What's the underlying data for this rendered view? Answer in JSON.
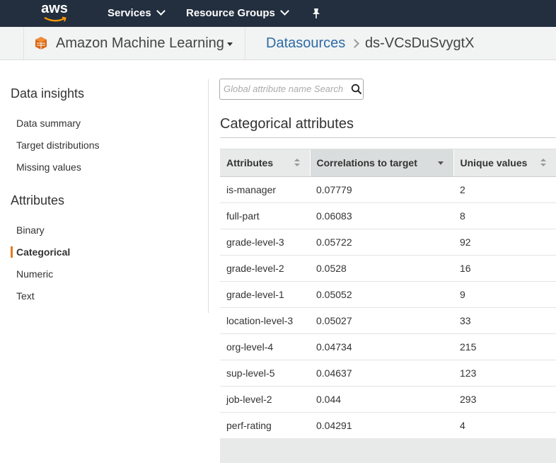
{
  "topnav": {
    "logo_text": "aws",
    "services_label": "Services",
    "resource_groups_label": "Resource Groups"
  },
  "subheader": {
    "service_name": "Amazon Machine Learning",
    "breadcrumb_link": "Datasources",
    "breadcrumb_current": "ds-VCsDuSvygtX"
  },
  "sidebar": {
    "data_insights_heading": "Data insights",
    "data_insights_items": [
      "Data summary",
      "Target distributions",
      "Missing values"
    ],
    "attributes_heading": "Attributes",
    "attribute_items": [
      "Binary",
      "Categorical",
      "Numeric",
      "Text"
    ],
    "active_item": "Categorical"
  },
  "search": {
    "placeholder": "Global attribute name Search"
  },
  "section_title": "Categorical attributes",
  "table": {
    "columns": [
      "Attributes",
      "Correlations to target",
      "Unique values"
    ],
    "sorted_column": "Correlations to target",
    "rows": [
      [
        "is-manager",
        "0.07779",
        "2"
      ],
      [
        "full-part",
        "0.06083",
        "8"
      ],
      [
        "grade-level-3",
        "0.05722",
        "92"
      ],
      [
        "grade-level-2",
        "0.0528",
        "16"
      ],
      [
        "grade-level-1",
        "0.05052",
        "9"
      ],
      [
        "location-level-3",
        "0.05027",
        "33"
      ],
      [
        "org-level-4",
        "0.04734",
        "215"
      ],
      [
        "sup-level-5",
        "0.04637",
        "123"
      ],
      [
        "job-level-2",
        "0.044",
        "293"
      ],
      [
        "perf-rating",
        "0.04291",
        "4"
      ]
    ]
  },
  "colors": {
    "nav_bg": "#232f3e",
    "link": "#2e6ca6",
    "accent": "#e07a1f"
  }
}
